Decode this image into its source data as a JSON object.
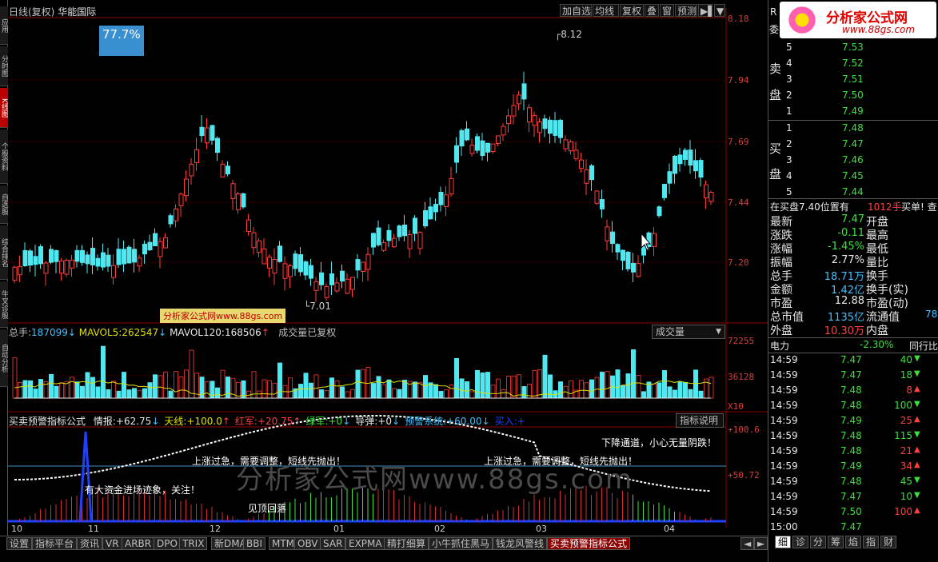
{
  "window": {
    "title_prefix": "日线(复权)",
    "stock_name": "华能国际"
  },
  "left_tabs": [
    "应用",
    "分时图",
    "K线图",
    "个股资料",
    "自选股",
    "综合排名",
    "牛叉诊股",
    "自动分析"
  ],
  "toolbar": {
    "items": [
      "加自选",
      "均线",
      "复权",
      "叠",
      "窗",
      "预测",
      "▶▌",
      "▼"
    ]
  },
  "price_scale": [
    "8.18",
    "7.94",
    "7.69",
    "7.44",
    "7.20"
  ],
  "volume_scale": [
    "72255",
    "36128",
    "X10"
  ],
  "indicator_scale": [
    "+100.6",
    "+50.72"
  ],
  "badge_pct": "77.7%",
  "watermark_small": "分析家公式网www.88gs.com",
  "watermark_big": "分析家公式网www.88gs.com",
  "high_label": "8.12",
  "low_label": "7.01",
  "volume_header": {
    "total_label": "总手:",
    "total_value": "187099",
    "total_arrow": "↓",
    "mavol5_label": "MAVOL5:",
    "mavol5_value": "262547",
    "mavol5_arrow": "↓",
    "mavol120_label": "MAVOL120:",
    "mavol120_value": "168506",
    "mavol120_arrow": "↑",
    "note": "成交量已复权",
    "dropdown": "成交量"
  },
  "indicator_header": {
    "name": "买卖预警指标公式",
    "items": [
      {
        "label": "情报:",
        "value": "+62.75",
        "arrow": "↓",
        "color": "#e8e8e8"
      },
      {
        "label": "天线:",
        "value": "+100.0",
        "arrow": "↑",
        "color": "#e0e000"
      },
      {
        "label": "红军:",
        "value": "+20.75",
        "arrow": "↑",
        "color": "#ff4040"
      },
      {
        "label": "绿军:",
        "value": "+0",
        "arrow": "↓",
        "color": "#3ee03e"
      },
      {
        "label": "导弹:",
        "value": "+0",
        "arrow": "↓",
        "color": "#e8e8e8"
      },
      {
        "label": "预警系统:",
        "value": "+60.00",
        "arrow": "↓",
        "color": "#40c0ff"
      },
      {
        "label": "买入:",
        "value": "+",
        "arrow": "",
        "color": "#2040ff"
      }
    ],
    "help_button": "指标说明"
  },
  "indicator_notes": [
    "下降通道，小心无量阴跌！",
    "上涨过急，需要调整，短线先抛出！",
    "上涨过急，需要调整，短线先抛出！",
    "有大资金进场迹象，关注！",
    "见顶回落"
  ],
  "x_months": [
    "10",
    "11",
    "12",
    "01",
    "02",
    "03",
    "04"
  ],
  "bottom_tabs": [
    "设置",
    "指标平台",
    "资讯",
    "VR",
    "ARBR",
    "DPO",
    "TRIX",
    "新DMA",
    "BBI",
    "MTM",
    "OBV",
    "SAR",
    "EXPMA",
    "精打细算",
    "小牛抓住黑马",
    "钱龙风警线",
    "买卖预警指标公式"
  ],
  "bottom_arrows": [
    "◄",
    "►"
  ],
  "right_panel": {
    "header_r": "R",
    "logo_text": "分析家公式网",
    "logo_url": "www.88gs.com",
    "sell_label": "卖盘",
    "buy_label": "买盘",
    "weibi_label": "委",
    "sells": [
      {
        "lvl": "5",
        "price": "7.53"
      },
      {
        "lvl": "4",
        "price": "7.52"
      },
      {
        "lvl": "3",
        "price": "7.51"
      },
      {
        "lvl": "2",
        "price": "7.50"
      },
      {
        "lvl": "1",
        "price": "7.49"
      }
    ],
    "buys": [
      {
        "lvl": "1",
        "price": "7.48"
      },
      {
        "lvl": "2",
        "price": "7.47"
      },
      {
        "lvl": "3",
        "price": "7.46"
      },
      {
        "lvl": "4",
        "price": "7.45"
      },
      {
        "lvl": "5",
        "price": "7.44"
      }
    ],
    "notice_a": "在买盘7.40位置有",
    "notice_b": "1012手",
    "notice_c": "买单! 查",
    "stats": [
      {
        "l1": "最新",
        "v1": "7.47",
        "c1": "#3ee03e",
        "l2": "开盘"
      },
      {
        "l1": "涨跌",
        "v1": "-0.11",
        "c1": "#3ee03e",
        "l2": "最高"
      },
      {
        "l1": "涨幅",
        "v1": "-1.45%",
        "c1": "#3ee03e",
        "l2": "最低"
      },
      {
        "l1": "振幅",
        "v1": "2.77%",
        "c1": "#e8e8e8",
        "l2": "量比"
      },
      {
        "l1": "总手",
        "v1": "18.71万",
        "c1": "#40c0ff",
        "l2": "换手"
      },
      {
        "l1": "金额",
        "v1": "1.42亿",
        "c1": "#40c0ff",
        "l2": "换手(实)"
      },
      {
        "l1": "市盈",
        "v1": "12.88",
        "c1": "#e8e8e8",
        "l2": "市盈(动)"
      },
      {
        "l1": "总市值",
        "v1": "1135亿",
        "c1": "#40c0ff",
        "l2": "流通值",
        "v2": "78"
      },
      {
        "l1": "外盘",
        "v1": "10.30万",
        "c1": "#ff4040",
        "l2": "内盘"
      }
    ],
    "power_label": "电力",
    "power_value": "-2.30%",
    "peer_label": "同行比",
    "ticks": [
      {
        "t": "14:59",
        "p": "7.47",
        "v": "40",
        "d": "down"
      },
      {
        "t": "14:59",
        "p": "7.47",
        "v": "18",
        "d": "down"
      },
      {
        "t": "14:59",
        "p": "7.48",
        "v": "8",
        "d": "up"
      },
      {
        "t": "14:59",
        "p": "7.48",
        "v": "100",
        "d": "down"
      },
      {
        "t": "14:59",
        "p": "7.49",
        "v": "25",
        "d": "up"
      },
      {
        "t": "14:59",
        "p": "7.48",
        "v": "115",
        "d": "down"
      },
      {
        "t": "14:59",
        "p": "7.48",
        "v": "21",
        "d": "up"
      },
      {
        "t": "14:59",
        "p": "7.49",
        "v": "34",
        "d": "up"
      },
      {
        "t": "14:59",
        "p": "7.48",
        "v": "45",
        "d": "down"
      },
      {
        "t": "14:59",
        "p": "7.47",
        "v": "10",
        "d": "down"
      },
      {
        "t": "14:59",
        "p": "7.50",
        "v": "100",
        "d": "up"
      },
      {
        "t": "15:00",
        "p": "7.47",
        "v": "",
        "d": ""
      }
    ],
    "bottom_tabs": [
      "细",
      "诊",
      "分",
      "筹",
      "焰",
      "指",
      "财"
    ]
  },
  "colors": {
    "up": "#ff3c3c",
    "down": "#50e8f0",
    "grid": "#700000",
    "vol_up": "#c83030",
    "vol_down": "#50e8f0"
  }
}
